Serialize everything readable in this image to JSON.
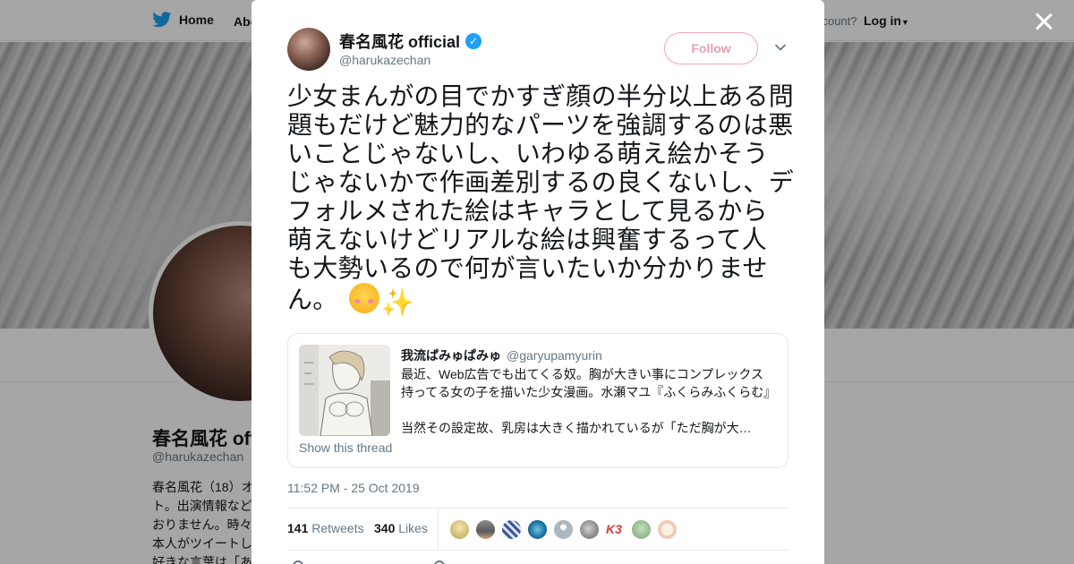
{
  "background_page": {
    "nav": {
      "home_label": "Home",
      "about_label": "Abo",
      "account_prompt": "ccount?",
      "login_label": "Log in"
    },
    "profile": {
      "name": "春名風花 offi",
      "handle": "@harukazechan",
      "bio_lines": [
        "春名風花（18）オ",
        "ト。出演情報など",
        "おりません。時々",
        "本人がツイートし",
        "好きな言葉は「あ"
      ]
    }
  },
  "tweet": {
    "author": {
      "name": "春名風花 official",
      "handle": "@harukazechan",
      "verified_icon": "verified-badge-icon"
    },
    "follow_label": "Follow",
    "text_lines": [
      "少女まんがの目でかすぎ顔の半分以上ある問",
      "題もだけど魅力的なパーツを強調するのは悪",
      "いことじゃないし、いわゆる萌え絵かそう",
      "じゃないかで作画差別するの良くないし、デ",
      "フォルメされた絵はキャラとして見るから",
      "萌えないけどリアルな絵は興奮するって人",
      "も大勢いるので何が言いたいか分かりませ",
      "ん。"
    ],
    "emojis": [
      "smiling-face-icon",
      "sparkles-icon"
    ],
    "quoted": {
      "name": "我流ぱみゅぱみゅ",
      "handle": "@garyupamyurin",
      "body_lines": [
        "最近、Web広告でも出てくる奴。胸が大きい事にコンプレックス",
        "持ってる女の子を描いた少女漫画。水瀬マユ『ふくらみふくらむ』",
        "",
        "当然その設定故、乳房は大きく描かれているが「ただ胸が大…"
      ],
      "show_thread_label": "Show this thread"
    },
    "timestamp": "11:52 PM - 25 Oct 2019",
    "retweets_count": "141",
    "retweets_label": "Retweets",
    "likes_count": "340",
    "likes_label": "Likes",
    "liker_badge_text": "K3"
  },
  "colors": {
    "twitter_blue": "#1da1f2",
    "follow_border": "#f4a6b6",
    "text_primary": "#14171a",
    "text_secondary": "#657786"
  }
}
